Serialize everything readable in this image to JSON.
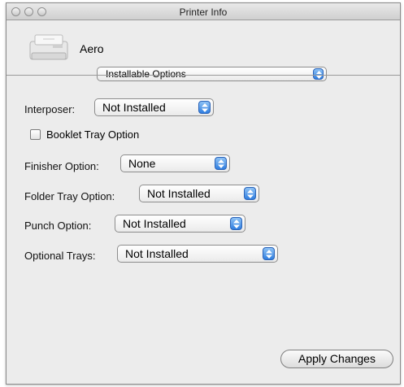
{
  "window": {
    "title": "Printer Info"
  },
  "printer": {
    "name": "Aero"
  },
  "panel_select": {
    "value": "Installable Options"
  },
  "options": {
    "interposer": {
      "label": "Interposer:",
      "value": "Not Installed"
    },
    "booklet_tray": {
      "label": "Booklet Tray Option",
      "checked": false
    },
    "finisher": {
      "label": "Finisher Option:",
      "value": "None"
    },
    "folder_tray": {
      "label": "Folder Tray Option:",
      "value": "Not Installed"
    },
    "punch": {
      "label": "Punch Option:",
      "value": "Not Installed"
    },
    "optional_trays": {
      "label": "Optional Trays:",
      "value": "Not Installed"
    }
  },
  "actions": {
    "apply_label": "Apply Changes"
  },
  "icons": {
    "close": "close-button-icon",
    "minimize": "minimize-button-icon",
    "zoom": "zoom-button-icon",
    "printer": "printer-icon",
    "popup_arrows": "popup-arrows-icon"
  },
  "colors": {
    "popup_arrow_blue": "#2f7ee0",
    "window_bg": "#ececec"
  }
}
